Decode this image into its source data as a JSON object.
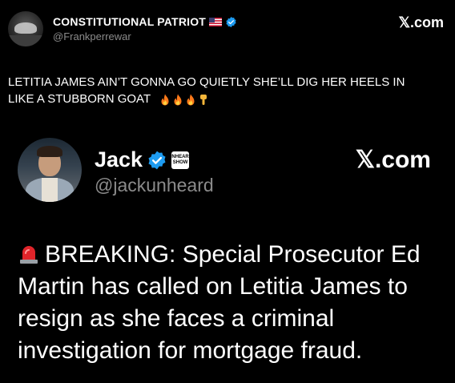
{
  "outer_post": {
    "author_name": "CONSTITUTIONAL PATRIOT",
    "author_handle": "@Frankperrewar",
    "source_label": "𝕏.com",
    "text_line1": "LETITIA JAMES AIN’T GONNA GO QUIETLY SHE’LL DIG HER HEELS IN",
    "text_line2": "LIKE A STUBBORN GOAT",
    "emojis": [
      "fire-icon",
      "fire-icon",
      "fire-icon",
      "pointing-down-icon"
    ]
  },
  "quoted_post": {
    "author_name": "Jack",
    "author_handle": "@jackunheard",
    "badge_text_top": "UNHEARD",
    "badge_text_bottom": "SHOW",
    "source_label": "𝕏.com",
    "text": "BREAKING: Special Prosecutor Ed Martin has called on Letitia James to resign as she faces a criminal investigation for mortgage fraud."
  },
  "colors": {
    "background": "#000000",
    "text_primary": "#ffffff",
    "text_secondary": "#8b8b8b",
    "verified_blue": "#1d9bf0",
    "fire_orange": "#ff7a1a",
    "siren_red": "#e0242a"
  }
}
